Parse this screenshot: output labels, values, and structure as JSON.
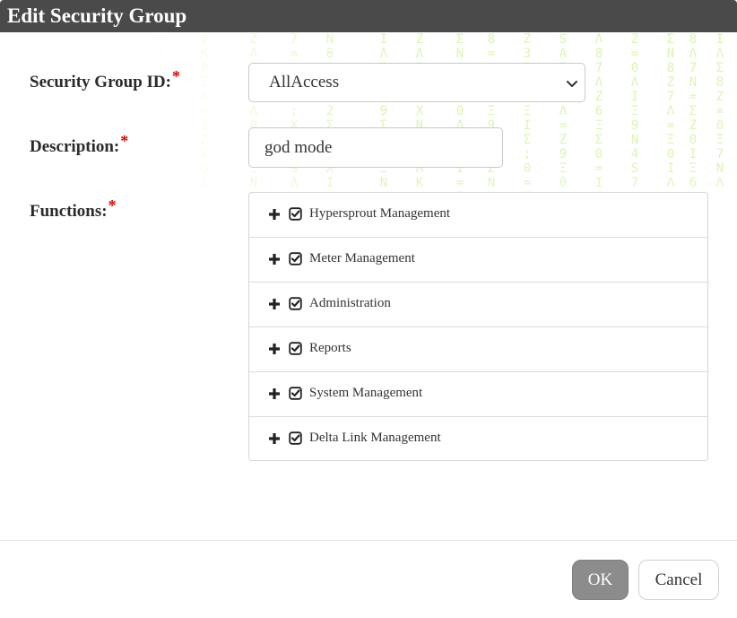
{
  "dialog": {
    "title": "Edit Security Group"
  },
  "form": {
    "security_group_id": {
      "label": "Security Group ID:",
      "required_marker": "*",
      "selected_value": "AllAccess"
    },
    "description": {
      "label": "Description:",
      "required_marker": "*",
      "value": "god mode"
    },
    "functions": {
      "label": "Functions:",
      "required_marker": "*",
      "items": [
        {
          "label": "Hypersprout Management",
          "checked": true,
          "expanded": false
        },
        {
          "label": "Meter Management",
          "checked": true,
          "expanded": false
        },
        {
          "label": "Administration",
          "checked": true,
          "expanded": false
        },
        {
          "label": "Reports",
          "checked": true,
          "expanded": false
        },
        {
          "label": "System Management",
          "checked": true,
          "expanded": false
        },
        {
          "label": "Delta Link Management",
          "checked": true,
          "expanded": false
        }
      ]
    }
  },
  "buttons": {
    "ok_label": "OK",
    "cancel_label": "Cancel"
  },
  "colors": {
    "title_bar": "#4a4a4a",
    "required": "#e00000",
    "ok_button": "#8c8c8c",
    "watermark": "#c9f08a"
  },
  "icons": {
    "expand": "plus-icon",
    "checkbox": "checkbox-checked-icon",
    "dropdown": "chevron-down-icon"
  }
}
